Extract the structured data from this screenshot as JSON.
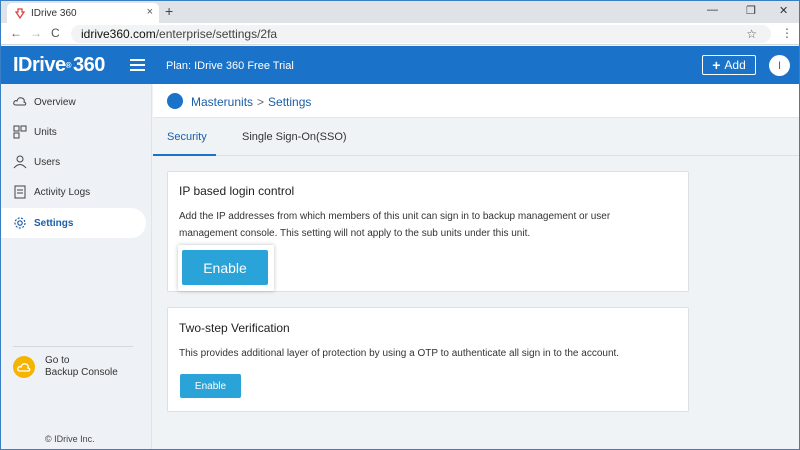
{
  "browser": {
    "tab_title": "IDrive 360",
    "tab_close": "×",
    "new_tab": "+",
    "url_host": "idrive360.com",
    "url_path": "/enterprise/settings/2fa",
    "back": "←",
    "forward": "→",
    "reload": "C",
    "minimize": "—",
    "restore": "❐",
    "close": "✕",
    "star": "☆",
    "menu": "⋮"
  },
  "header": {
    "logo_text": "IDrive",
    "logo_reg": "®",
    "logo_suffix": "360",
    "plan": "Plan: IDrive 360 Free Trial",
    "add_plus": "+",
    "add_label": "Add",
    "avatar_letter": "I",
    "accent": "#1a73c8"
  },
  "sidebar": {
    "items": [
      {
        "label": "Overview",
        "icon": "cloud-icon"
      },
      {
        "label": "Units",
        "icon": "units-icon"
      },
      {
        "label": "Users",
        "icon": "user-icon"
      },
      {
        "label": "Activity Logs",
        "icon": "log-icon"
      },
      {
        "label": "Settings",
        "icon": "gear-icon",
        "active": true
      }
    ],
    "backup_line1": "Go to",
    "backup_line2": "Backup Console",
    "copyright": "© IDrive Inc."
  },
  "breadcrumb": {
    "root": "Masterunits",
    "separator": ">",
    "current": "Settings"
  },
  "tabs": [
    {
      "label": "Security",
      "active": true
    },
    {
      "label": "Single Sign-On(SSO)",
      "active": false
    }
  ],
  "cards": {
    "ip": {
      "title": "IP based login control",
      "desc": "Add the IP addresses from which members of this unit can sign in to backup management or user management console. This setting will not apply to the sub units under this unit.",
      "button": "Enable"
    },
    "twostep": {
      "title": "Two-step Verification",
      "desc": "This provides additional layer of protection by using a OTP to authenticate all sign in to the account.",
      "button": "Enable"
    }
  },
  "colors": {
    "button": "#2aa3d9",
    "link": "#1a5fa8",
    "backup_icon": "#f5b400"
  }
}
